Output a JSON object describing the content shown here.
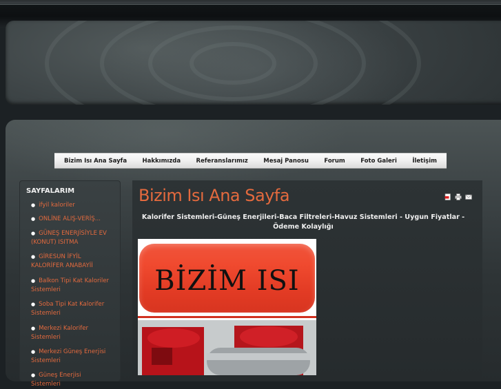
{
  "nav": {
    "items": [
      "Bizim Isı Ana Sayfa",
      "Hakkımızda",
      "Referanslarımız",
      "Mesaj Panosu",
      "Forum",
      "Foto Galeri",
      "İletişim"
    ]
  },
  "sidebar": {
    "title": "SAYFALARIM",
    "items": [
      "ifyil kaloriler",
      "ONLİNE ALIŞ-VERİŞ...",
      "GÜNEŞ ENERJİSİYLE EV (KONUT) ISITMA",
      "GİRESUN İFYİL KALORİFER ANABAYİİ",
      "Balkon Tipi Kat Kaloriler Sistemleri",
      "Soba Tipi Kat Kalorifer Sistemleri",
      "Merkezi Kalorifer Sistemleri",
      "Merkezi Güneş Enerjisi Sistemleri",
      "Güneş Enerjisi Sistemleri"
    ]
  },
  "content": {
    "title": "Bizim Isı Ana Sayfa",
    "intro": "Kalorifer Sistemleri-Güneş Enerjileri-Baca Filtreleri-Havuz Sistemleri - Uygun Fiyatlar - Ödeme Kolaylığı",
    "banner_text": "BİZİM ISI",
    "icons": [
      "pdf-icon",
      "print-icon",
      "email-icon"
    ]
  },
  "colors": {
    "accent": "#e46a3e",
    "banner_red": "#e84429",
    "nav_bg": "#f1f1f1"
  }
}
